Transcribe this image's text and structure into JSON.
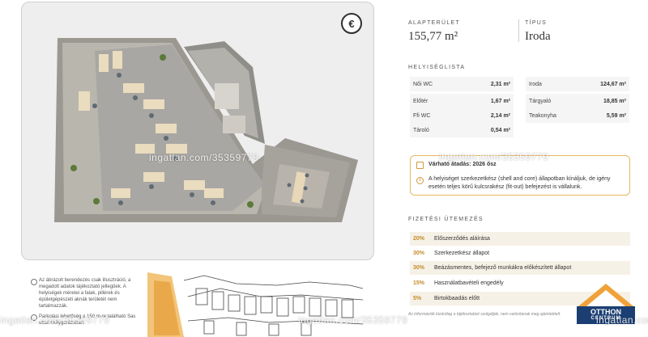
{
  "plan": {
    "brand_icon": "€"
  },
  "notes": {
    "illustration": "Az ábrázolt berendezés csak illusztráció, a megadott adatok tájékoztató jellegűek. A helyiségek méretei a falak, pillérek és épületgépészeti aknák területét nem tartalmazzák.",
    "parking": "Parkolási lehetőség a 150 m-re található Sas utcai mélygarázsban."
  },
  "info": {
    "area_label": "ALAPTERÜLET",
    "area_value": "155,77 m²",
    "type_label": "TÍPUS",
    "type_value": "Iroda",
    "rooms_label": "HELYISÉGLISTA",
    "rooms_left": [
      {
        "name": "Női WC",
        "value": "2,31 m²"
      },
      {
        "name": "Előtér",
        "value": "1,67 m²"
      },
      {
        "name": "Ffi WC",
        "value": "2,14 m²"
      },
      {
        "name": "Tároló",
        "value": "0,54 m²"
      }
    ],
    "rooms_right": [
      {
        "name": "Iroda",
        "value": "124,67 m²"
      },
      {
        "name": "Tárgyaló",
        "value": "18,85 m²"
      },
      {
        "name": "Teakonyha",
        "value": "5,59 m²"
      }
    ]
  },
  "notice": {
    "handover_label": "Várható átadás:",
    "handover_value": "2026 ősz",
    "text": "A helyiséget szerkezetkész (shell and core) állapotban kínáljuk, de igény esetén teljes körű kulcsrakész (fit-out) befejezést is vállalunk.",
    "accent_color": "#e7b761"
  },
  "payment": {
    "label": "FIZETÉSI ÜTEMEZÉS",
    "items": [
      {
        "pct": "20%",
        "desc": "Előszerződés aláírása"
      },
      {
        "pct": "30%",
        "desc": "Szerkezetkész állapot"
      },
      {
        "pct": "30%",
        "desc": "Beázásmentes, befejező munkákra előkészített állapot"
      },
      {
        "pct": "15%",
        "desc": "Használatbavételi engedély"
      },
      {
        "pct": "5%",
        "desc": "Birtokbaadás előtt"
      }
    ],
    "disclaimer": "Az információk kizárólag a tájékoztatást szolgálják, nem valósítanak meg ajánlatételt."
  },
  "logo": {
    "line1": "OTTHON",
    "line2": "CENTRUM",
    "color": "#1b3f73"
  },
  "watermark": "ingatlan.com/35359779"
}
